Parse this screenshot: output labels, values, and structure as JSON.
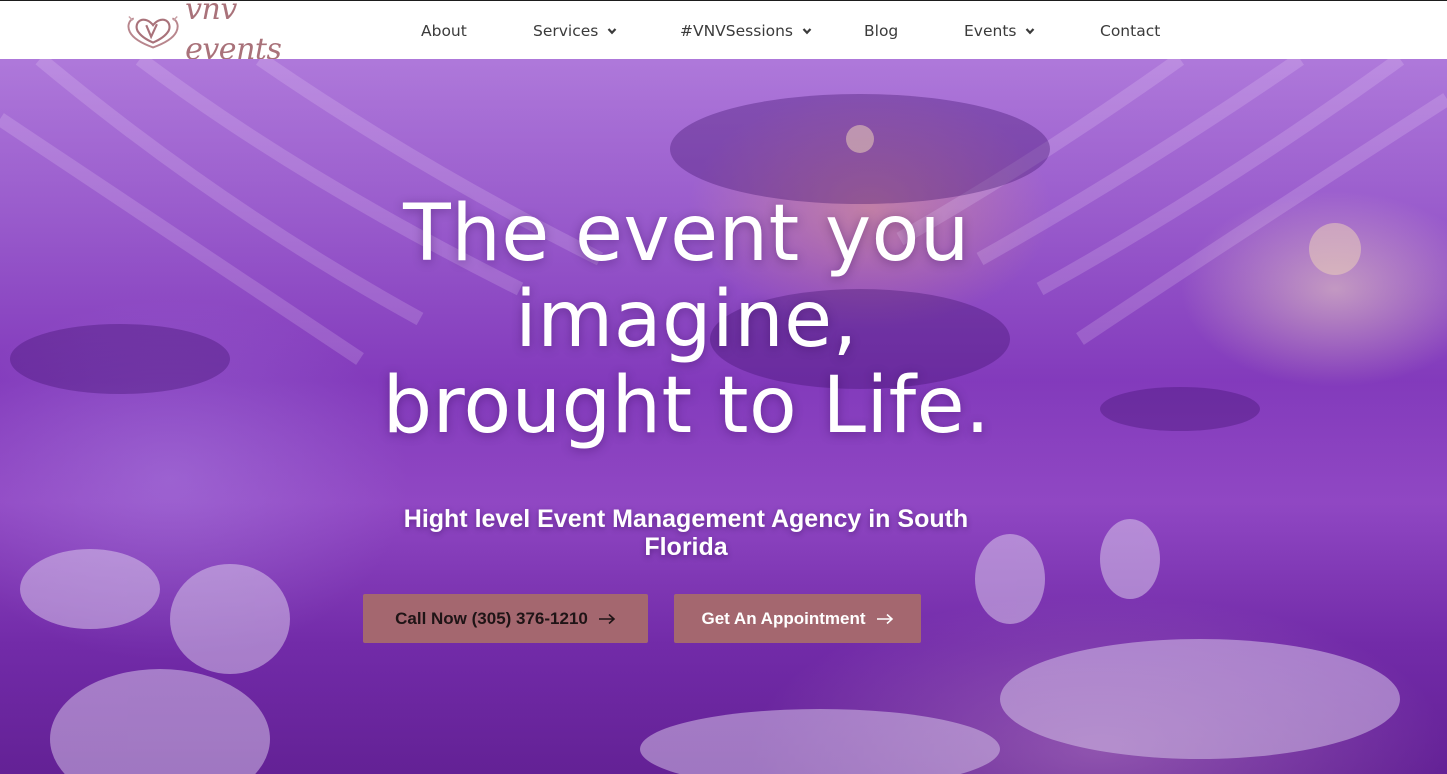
{
  "brand": {
    "logo_text": "vnv events",
    "logo_color": "#a9727a"
  },
  "nav": {
    "items": [
      {
        "label": "About",
        "has_dropdown": false
      },
      {
        "label": "Services",
        "has_dropdown": true
      },
      {
        "label": "#VNVSessions",
        "has_dropdown": true
      },
      {
        "label": "Blog",
        "has_dropdown": false
      },
      {
        "label": "Events",
        "has_dropdown": true
      },
      {
        "label": "Contact",
        "has_dropdown": false
      }
    ]
  },
  "hero": {
    "headline_lines": [
      "The event you",
      "imagine,",
      "brought to Life."
    ],
    "subheadline": "Hight level Event Management Agency in South Florida",
    "buttons": {
      "call_label": "Call Now (305) 376-1210",
      "appointment_label": "Get An Appointment"
    },
    "button_color": "#a4676f",
    "icons": {
      "button_arrow": "arrow-right-icon",
      "dropdown": "chevron-down-icon"
    }
  }
}
